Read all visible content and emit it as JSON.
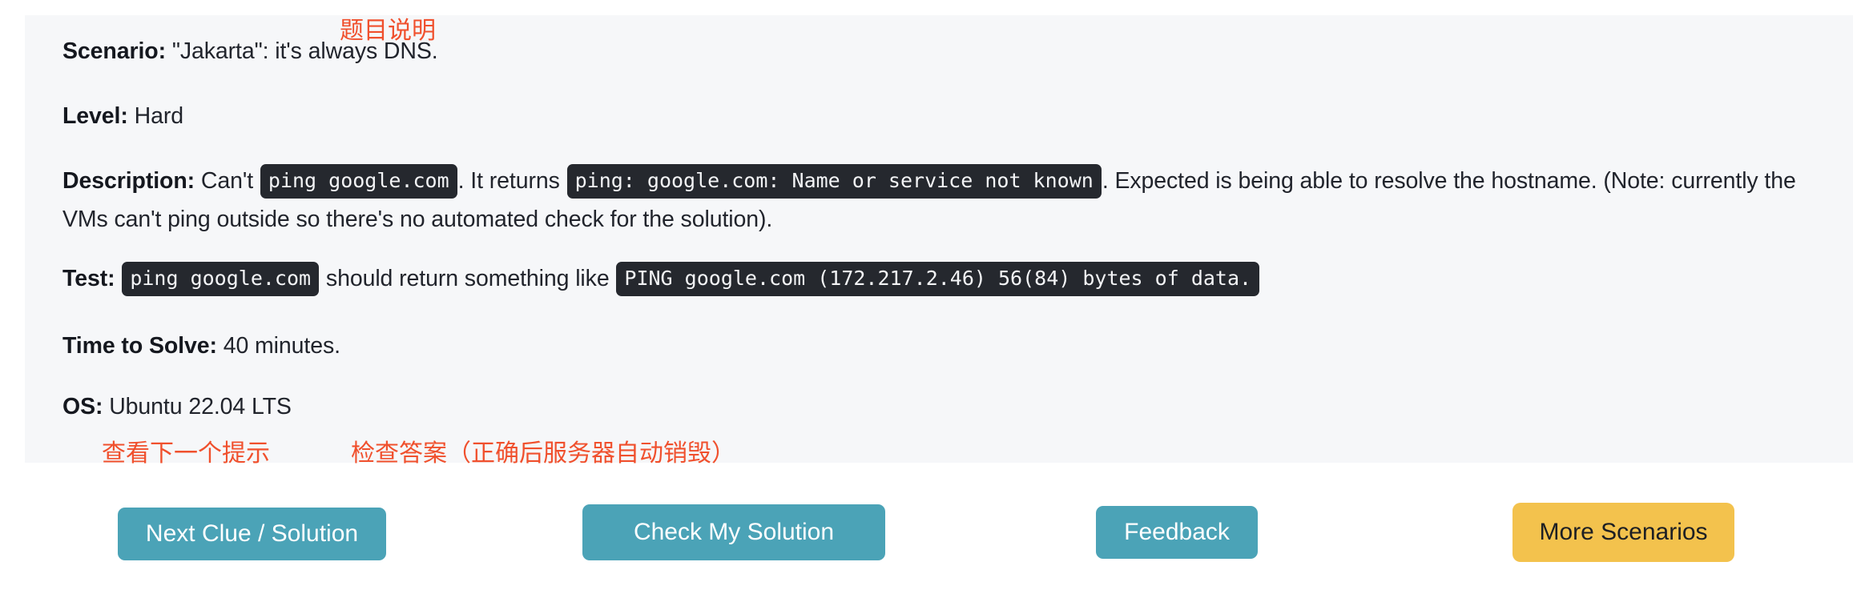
{
  "panel": {
    "scenario": {
      "label": "Scenario:",
      "value": "\"Jakarta\": it's always DNS."
    },
    "level": {
      "label": "Level:",
      "value": "Hard"
    },
    "description": {
      "label": "Description:",
      "text_1": "Can't",
      "code_1": "ping google.com",
      "text_2": ". It returns",
      "code_2": "ping: google.com: Name or service not known",
      "text_3": ". Expected is being able to resolve the hostname. (Note: currently the VMs can't ping outside so there's no automated check for the solution)."
    },
    "test": {
      "label": "Test:",
      "code_1": "ping google.com",
      "text_1": "should return something like",
      "code_2": "PING google.com (172.217.2.46) 56(84) bytes of data."
    },
    "time_to_solve": {
      "label": "Time to Solve:",
      "value": "40 minutes."
    },
    "os": {
      "label": "OS:",
      "value": "Ubuntu 22.04 LTS"
    }
  },
  "annotations": {
    "title": "题目说明",
    "next_clue": "查看下一个提示",
    "check_solution": "检查答案（正确后服务器自动销毁）",
    "color": "#f0502d"
  },
  "buttons": {
    "next_clue": "Next Clue / Solution",
    "check_solution": "Check My Solution",
    "feedback": "Feedback",
    "more_scenarios": "More Scenarios",
    "primary_color": "#4ba3b7",
    "accent_color": "#f3c24d"
  }
}
